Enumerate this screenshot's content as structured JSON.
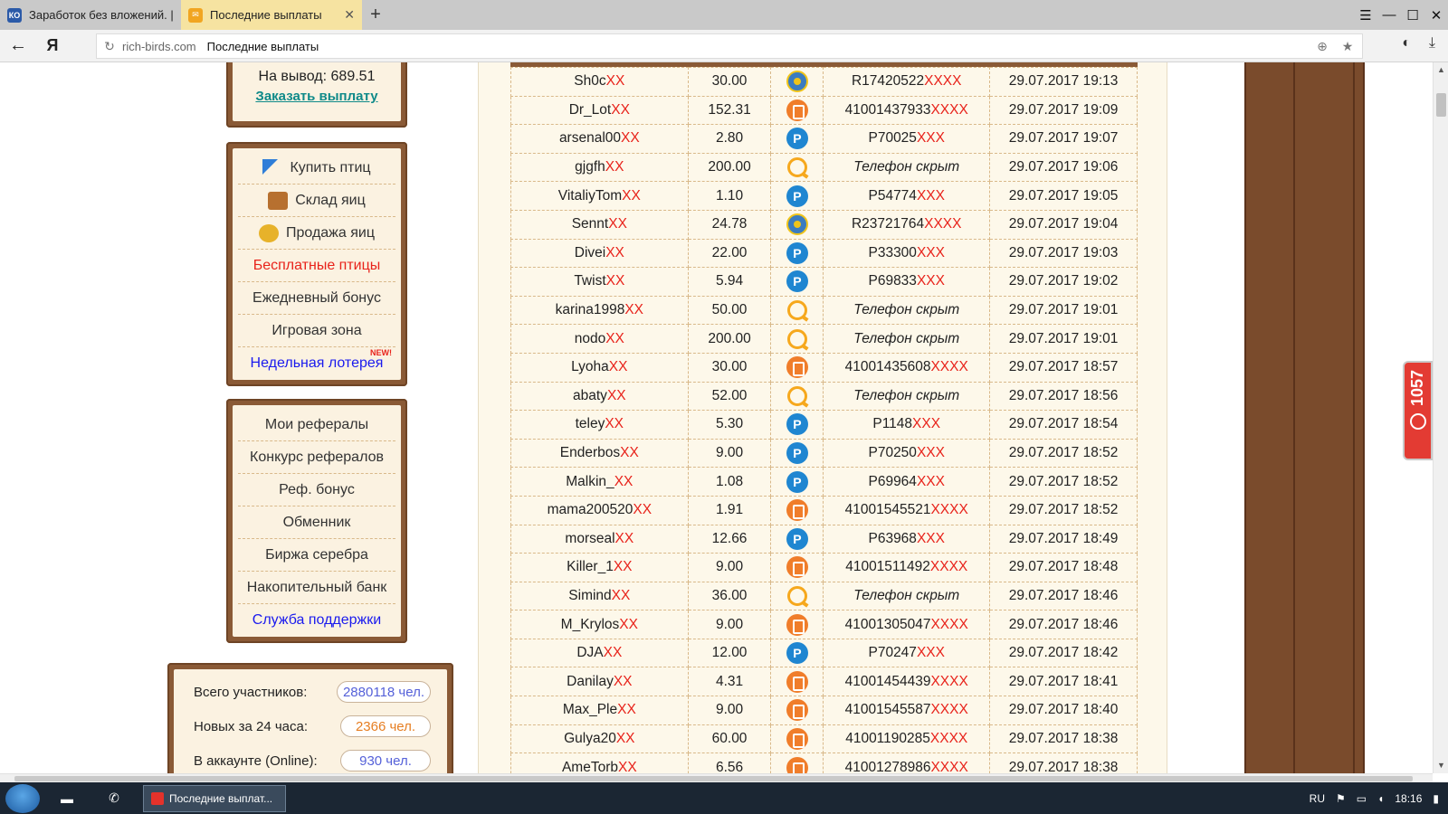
{
  "browser": {
    "tabs": [
      {
        "title": "Заработок без вложений. |",
        "active": false
      },
      {
        "title": "Последние выплаты",
        "active": true
      }
    ],
    "new_tab": "+",
    "window_buttons": [
      "☰",
      "—",
      "☐",
      "✕"
    ],
    "address": {
      "host": "rich-birds.com",
      "title": "Последние выплаты"
    },
    "back": "←",
    "yandex_logo": "Я"
  },
  "balance": {
    "withdraw_line": "На вывод: 689.51",
    "order_link": "Заказать выплату"
  },
  "menu_main": [
    {
      "label": "Купить птиц",
      "icon": "cart-icon",
      "style": "normal"
    },
    {
      "label": "Склад яиц",
      "icon": "box-icon",
      "style": "normal"
    },
    {
      "label": "Продажа яиц",
      "icon": "coins-icon",
      "style": "normal"
    },
    {
      "label": "Бесплатные птицы",
      "icon": "",
      "style": "red"
    },
    {
      "label": "Ежедневный бонус",
      "icon": "",
      "style": "normal"
    },
    {
      "label": "Игровая зона",
      "icon": "",
      "style": "normal"
    },
    {
      "label": "Недельная лотерея",
      "icon": "",
      "style": "blue"
    }
  ],
  "new_badge": "NEW!",
  "menu_ref": [
    {
      "label": "Мои рефералы",
      "style": "normal"
    },
    {
      "label": "Конкурс рефералов",
      "style": "normal"
    },
    {
      "label": "Реф. бонус",
      "style": "normal"
    },
    {
      "label": "Обменник",
      "style": "normal"
    },
    {
      "label": "Биржа серебра",
      "style": "normal"
    },
    {
      "label": "Накопительный банк",
      "style": "normal"
    },
    {
      "label": "Служба поддержки",
      "style": "blue"
    }
  ],
  "stats": [
    {
      "label": "Всего участников:",
      "value": "2880118 чел.",
      "color": "blue"
    },
    {
      "label": "Новых за 24 часа:",
      "value": "2366 чел.",
      "color": "orange"
    },
    {
      "label": "В аккаунте (Online):",
      "value": "930 чел.",
      "color": "blue"
    }
  ],
  "payouts": [
    {
      "user": "Sh0c",
      "amount": "30.00",
      "system": "webmoney",
      "account": "R17420522",
      "account_mask": "XXXX",
      "date": "29.07.2017 19:13"
    },
    {
      "user": "Dr_Lot",
      "amount": "152.31",
      "system": "yandex",
      "account": "41001437933",
      "account_mask": "XXXX",
      "date": "29.07.2017 19:09"
    },
    {
      "user": "arsenal00",
      "amount": "2.80",
      "system": "payeer",
      "account": "P70025",
      "account_mask": "XXX",
      "date": "29.07.2017 19:07"
    },
    {
      "user": "gjgfh",
      "amount": "200.00",
      "system": "qiwi",
      "account": "Телефон скрыт",
      "account_mask": "",
      "date": "29.07.2017 19:06"
    },
    {
      "user": "VitaliyTom",
      "amount": "1.10",
      "system": "payeer",
      "account": "P54774",
      "account_mask": "XXX",
      "date": "29.07.2017 19:05"
    },
    {
      "user": "Sennt",
      "amount": "24.78",
      "system": "webmoney",
      "account": "R23721764",
      "account_mask": "XXXX",
      "date": "29.07.2017 19:04"
    },
    {
      "user": "Divei",
      "amount": "22.00",
      "system": "payeer",
      "account": "P33300",
      "account_mask": "XXX",
      "date": "29.07.2017 19:03"
    },
    {
      "user": "Twist",
      "amount": "5.94",
      "system": "payeer",
      "account": "P69833",
      "account_mask": "XXX",
      "date": "29.07.2017 19:02"
    },
    {
      "user": "karina1998",
      "amount": "50.00",
      "system": "qiwi",
      "account": "Телефон скрыт",
      "account_mask": "",
      "date": "29.07.2017 19:01"
    },
    {
      "user": "nodo",
      "amount": "200.00",
      "system": "qiwi",
      "account": "Телефон скрыт",
      "account_mask": "",
      "date": "29.07.2017 19:01"
    },
    {
      "user": "Lyoha",
      "amount": "30.00",
      "system": "yandex",
      "account": "41001435608",
      "account_mask": "XXXX",
      "date": "29.07.2017 18:57"
    },
    {
      "user": "abaty",
      "amount": "52.00",
      "system": "qiwi",
      "account": "Телефон скрыт",
      "account_mask": "",
      "date": "29.07.2017 18:56"
    },
    {
      "user": "teley",
      "amount": "5.30",
      "system": "payeer",
      "account": "P1148",
      "account_mask": "XXX",
      "date": "29.07.2017 18:54"
    },
    {
      "user": "Enderbos",
      "amount": "9.00",
      "system": "payeer",
      "account": "P70250",
      "account_mask": "XXX",
      "date": "29.07.2017 18:52"
    },
    {
      "user": "Malkin_",
      "amount": "1.08",
      "system": "payeer",
      "account": "P69964",
      "account_mask": "XXX",
      "date": "29.07.2017 18:52"
    },
    {
      "user": "mama200520",
      "amount": "1.91",
      "system": "yandex",
      "account": "41001545521",
      "account_mask": "XXXX",
      "date": "29.07.2017 18:52"
    },
    {
      "user": "morseal",
      "amount": "12.66",
      "system": "payeer",
      "account": "P63968",
      "account_mask": "XXX",
      "date": "29.07.2017 18:49"
    },
    {
      "user": "Killer_1",
      "amount": "9.00",
      "system": "yandex",
      "account": "41001511492",
      "account_mask": "XXXX",
      "date": "29.07.2017 18:48"
    },
    {
      "user": "Simind",
      "amount": "36.00",
      "system": "qiwi",
      "account": "Телефон скрыт",
      "account_mask": "",
      "date": "29.07.2017 18:46"
    },
    {
      "user": "M_Krylos",
      "amount": "9.00",
      "system": "yandex",
      "account": "41001305047",
      "account_mask": "XXXX",
      "date": "29.07.2017 18:46"
    },
    {
      "user": "DJA",
      "amount": "12.00",
      "system": "payeer",
      "account": "P70247",
      "account_mask": "XXX",
      "date": "29.07.2017 18:42"
    },
    {
      "user": "Danilay",
      "amount": "4.31",
      "system": "yandex",
      "account": "41001454439",
      "account_mask": "XXXX",
      "date": "29.07.2017 18:41"
    },
    {
      "user": "Max_Ple",
      "amount": "9.00",
      "system": "yandex",
      "account": "41001545587",
      "account_mask": "XXXX",
      "date": "29.07.2017 18:40"
    },
    {
      "user": "Gulya20",
      "amount": "60.00",
      "system": "yandex",
      "account": "41001190285",
      "account_mask": "XXXX",
      "date": "29.07.2017 18:38"
    },
    {
      "user": "AmeTorb",
      "amount": "6.56",
      "system": "yandex",
      "account": "41001278986",
      "account_mask": "XXXX",
      "date": "29.07.2017 18:38"
    }
  ],
  "user_mask": "XX",
  "counter": {
    "value": "1057"
  },
  "taskbar": {
    "task_title": "Последние выплат...",
    "lang": "RU",
    "clock": "18:16"
  },
  "colors": {
    "mask_red": "#e8231b",
    "panel_brown": "#8a5a36",
    "link_teal": "#0f8a89"
  }
}
